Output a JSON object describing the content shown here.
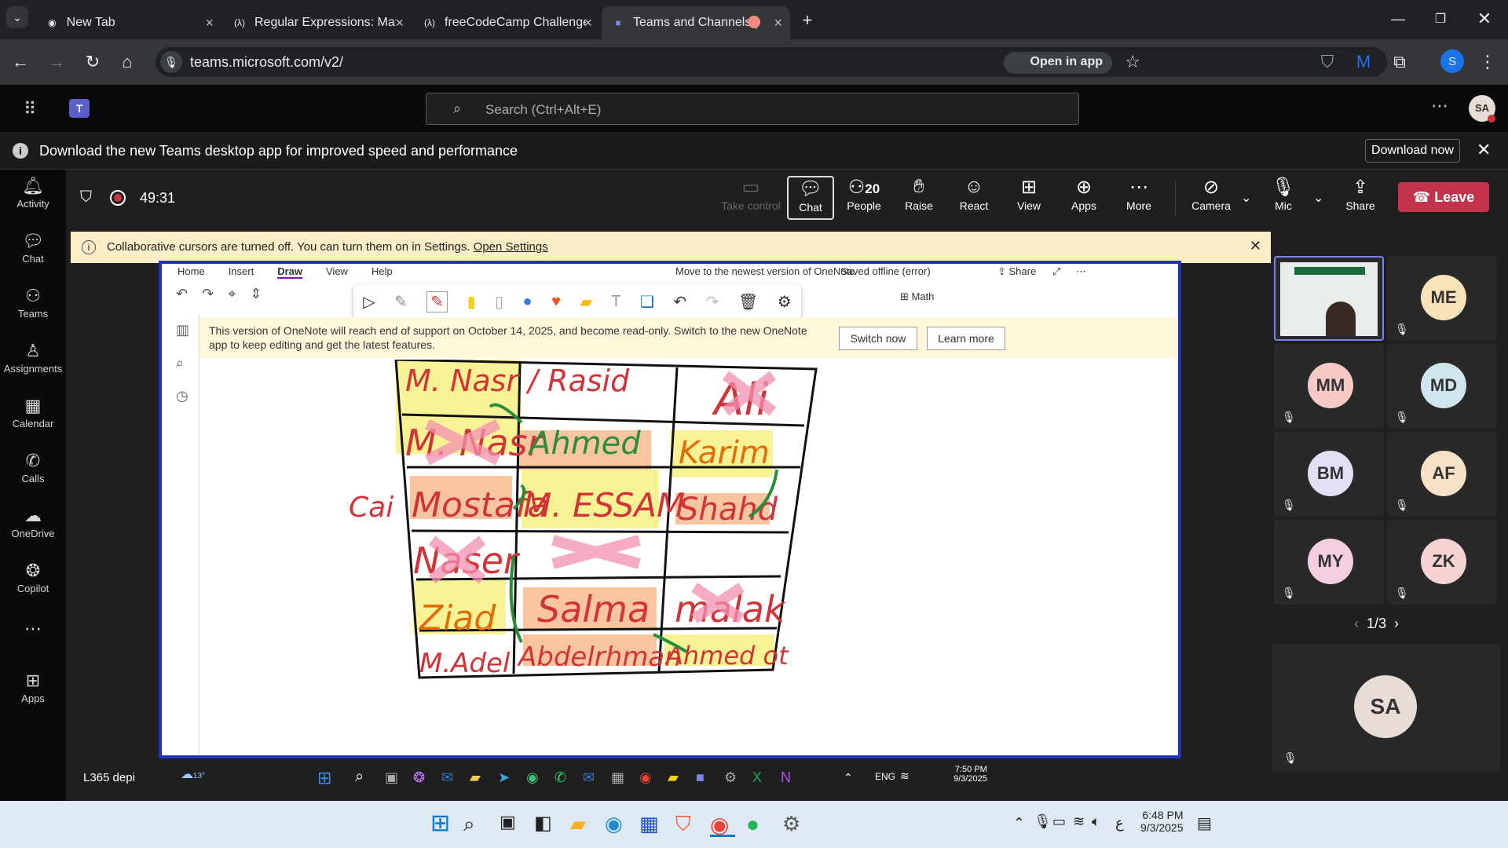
{
  "browser": {
    "tabs": [
      {
        "label": "New Tab",
        "active": false
      },
      {
        "label": "Regular Expressions: Match Sing",
        "active": false
      },
      {
        "label": "freeCodeCamp Challenge Guide",
        "active": false
      },
      {
        "label": "Teams and Channels | NHA",
        "active": true
      }
    ],
    "url": "teams.microsoft.com/v2/",
    "open_in_app": "Open in app",
    "profile_initial": "S"
  },
  "teams": {
    "search_placeholder": "Search (Ctrl+Alt+E)",
    "avatar": "SA",
    "banner_text": "Download the new Teams desktop app for improved speed and performance",
    "banner_button": "Download now"
  },
  "rail": [
    {
      "label": "Activity",
      "icon": "bell-icon"
    },
    {
      "label": "Chat",
      "icon": "chat-icon"
    },
    {
      "label": "Teams",
      "icon": "teams-icon"
    },
    {
      "label": "Assignments",
      "icon": "assignments-icon"
    },
    {
      "label": "Calendar",
      "icon": "calendar-icon"
    },
    {
      "label": "Calls",
      "icon": "phone-icon"
    },
    {
      "label": "OneDrive",
      "icon": "cloud-icon"
    },
    {
      "label": "Copilot",
      "icon": "copilot-icon"
    },
    {
      "label": "",
      "icon": "more-icon"
    },
    {
      "label": "Apps",
      "icon": "apps-icon"
    }
  ],
  "meeting": {
    "timer": "49:31",
    "controls": [
      {
        "label": "Take control",
        "icon": "take-control-icon"
      },
      {
        "label": "Chat",
        "icon": "chat-icon"
      },
      {
        "label": "People",
        "icon": "people-icon",
        "count": "20"
      },
      {
        "label": "Raise",
        "icon": "hand-icon"
      },
      {
        "label": "React",
        "icon": "smile-icon"
      },
      {
        "label": "View",
        "icon": "view-icon"
      },
      {
        "label": "Apps",
        "icon": "apps-icon"
      },
      {
        "label": "More",
        "icon": "more-icon"
      },
      {
        "label": "Camera",
        "icon": "camera-off-icon"
      },
      {
        "label": "Mic",
        "icon": "mic-off-icon"
      },
      {
        "label": "Share",
        "icon": "share-icon"
      }
    ],
    "leave": "Leave",
    "cursor_notice": "Collaborative cursors are turned off. You can turn them on in Settings.",
    "cursor_link": "Open Settings",
    "pager": "1/3",
    "self_initials": "SA"
  },
  "onenote": {
    "tabs": [
      "Home",
      "Insert",
      "Draw",
      "View",
      "Help"
    ],
    "move_text": "Move to the newest version of OneNote",
    "saved_text": "Saved offline (error)",
    "share": "Share",
    "math": "Math",
    "notice": "This version of OneNote will reach end of support on October 14, 2025, and become read-only. Switch to the new OneNote app to keep editing and get the latest features.",
    "switch_now": "Switch now",
    "learn_more": "Learn more"
  },
  "board_cells": [
    [
      "M. Nasr / Rasid",
      "",
      "Ali"
    ],
    [
      "M. Nasr",
      "Ahmed",
      "Karim"
    ],
    [
      "Mostafa",
      "M. ESSAM",
      "Shahd"
    ],
    [
      "Naser",
      "",
      ""
    ],
    [
      "Ziad",
      "Salma",
      "malak"
    ],
    [
      "M.Adel",
      "Abdelrhman",
      "Ahmed ot"
    ]
  ],
  "participants": [
    {
      "initials": "ME",
      "color": "#f8e3b8"
    },
    {
      "initials": "MM",
      "color": "#f6c9c5"
    },
    {
      "initials": "MD",
      "color": "#cfe6ee"
    },
    {
      "initials": "BM",
      "color": "#e5dff5"
    },
    {
      "initials": "AF",
      "color": "#f8e2c7"
    },
    {
      "initials": "MY",
      "color": "#f4cfe0"
    },
    {
      "initials": "ZK",
      "color": "#f6d3d3"
    }
  ],
  "remote_taskbar": {
    "label": "L365 depi",
    "weather": "13°",
    "lang": "ENG",
    "time": "7:50 PM",
    "date": "9/3/2025"
  },
  "taskbar": {
    "time": "6:48 PM",
    "date": "9/3/2025",
    "lang": "ع"
  }
}
